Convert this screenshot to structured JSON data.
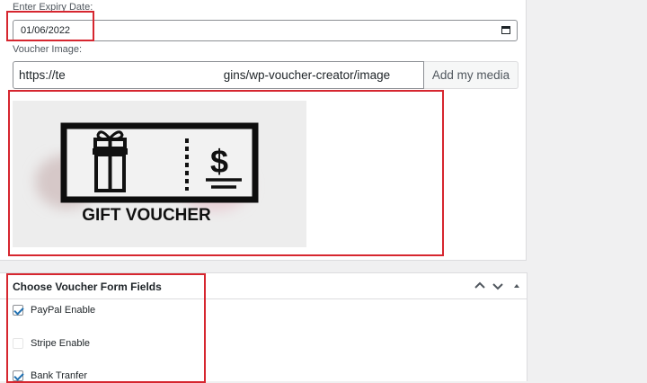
{
  "expiry": {
    "label": "Enter Expiry Date:",
    "value": "01/06/2022"
  },
  "voucher_image": {
    "label": "Voucher Image:",
    "url_start": "https://te",
    "url_end": "gins/wp-voucher-creator/image",
    "media_button": "Add my media",
    "preview_text": "GIFT VOUCHER",
    "preview_symbol": "$"
  },
  "form_fields": {
    "title": "Choose Voucher Form Fields",
    "items": [
      {
        "label": "PayPal Enable",
        "checked": true
      },
      {
        "label": "Stripe Enable",
        "checked": false
      },
      {
        "label": "Bank Tranfer",
        "checked": true
      }
    ]
  },
  "icons": [
    "calendar-icon",
    "chevron-up-icon",
    "chevron-down-icon",
    "triangle-up-icon"
  ],
  "colors": {
    "highlight": "#d6262f",
    "check": "#2271b1",
    "border": "#dcdcde"
  }
}
